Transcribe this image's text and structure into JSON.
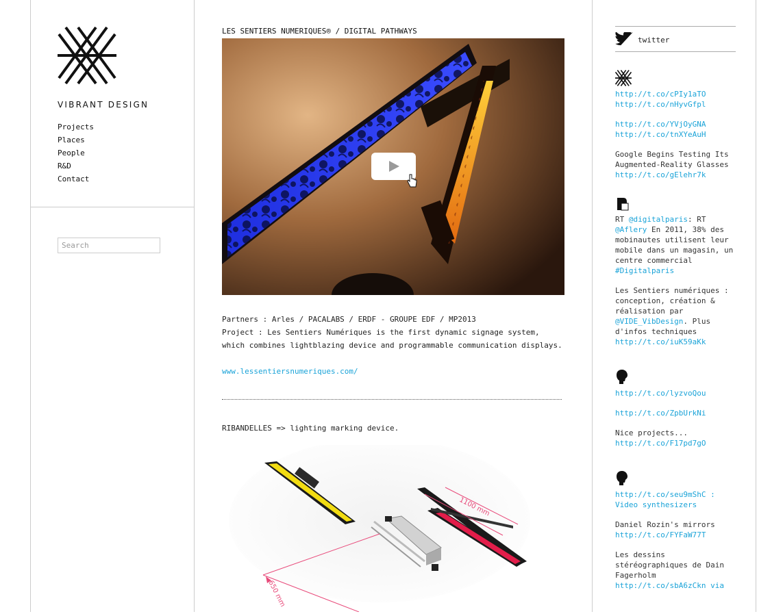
{
  "brand": {
    "name": "VIBRANT DESIGN"
  },
  "nav": {
    "items": [
      "Projects",
      "Places",
      "People",
      "R&D",
      "Contact"
    ]
  },
  "search": {
    "placeholder": "Search"
  },
  "project": {
    "title": "LES SENTIERS NUMERIQUES® / DIGITAL PATHWAYS",
    "partners": "Partners : Arles / PACALABS / ERDF - GROUPE EDF / MP2013",
    "description": "Project : Les Sentiers Numériques is the first dynamic signage system, which combines lightblazing device and programmable communication displays.",
    "url": "www.lessentiersnumeriques.com/",
    "ribandelles": "RIBANDELLES => lighting marking device.",
    "dim_a": "1100 mm",
    "dim_b": "650 mm"
  },
  "twitter": {
    "label": "twitter",
    "tweets": [
      {
        "avatar": "vibrant-logo",
        "lines": [
          [
            "http://t.co/cPIy1aTO",
            "http://t.co/nHyvGfpl"
          ],
          [
            "http://t.co/YVjOyGNA",
            "http://t.co/tnXYeAuH"
          ],
          [
            "Google Begins Testing Its Augmented-Reality Glasses",
            "http://t.co/gElehr7k"
          ]
        ]
      },
      {
        "avatar": "digitalparis",
        "lines": [
          [
            "RT @digitalparis: RT @Aflery En 2011, 38% des mobinautes utilisent leur mobile dans un magasin, un centre commercial #Digitalparis"
          ],
          [
            "Les Sentiers numériques : conception, création & réalisation par @VIDE_VibDesign. Plus d'infos techniques",
            "http://t.co/iuK59aKk"
          ]
        ]
      },
      {
        "avatar": "silhouette",
        "lines": [
          [
            "http://t.co/lyzvoQou"
          ],
          [
            "http://t.co/ZpbUrkNi"
          ],
          [
            "Nice projects...",
            "http://t.co/F17pd7gO"
          ]
        ]
      },
      {
        "avatar": "silhouette",
        "lines": [
          [
            "http://t.co/seu9mShC : Video synthesizers"
          ],
          [
            "Daniel Rozin's mirrors",
            "http://t.co/FYFaW77T"
          ],
          [
            "Les dessins stéréographiques de Dain Fagerholm",
            "http://t.co/sbA6zCkn via"
          ]
        ]
      }
    ]
  },
  "colors": {
    "link": "#1aa3d8",
    "border": "#cccccc"
  }
}
